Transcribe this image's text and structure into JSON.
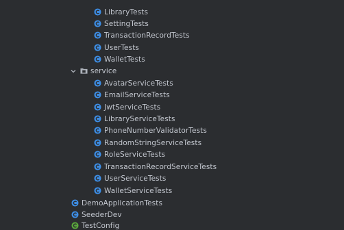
{
  "tree": {
    "colors": {
      "background": "#2b2d30",
      "text": "#c3c7cf",
      "test_class_icon": "#3d8ee6",
      "config_class_icon": "#5aa83c",
      "folder_icon": "#aeb3bb"
    },
    "items": [
      {
        "label": "LibraryTests",
        "icon": "test-class-icon",
        "level": 3
      },
      {
        "label": "SettingTests",
        "icon": "test-class-icon",
        "level": 3
      },
      {
        "label": "TransactionRecordTests",
        "icon": "test-class-icon",
        "level": 3
      },
      {
        "label": "UserTests",
        "icon": "test-class-icon",
        "level": 3
      },
      {
        "label": "WalletTests",
        "icon": "test-class-icon",
        "level": 3
      },
      {
        "label": "service",
        "icon": "package-folder-icon",
        "level": 2,
        "expanded": true
      },
      {
        "label": "AvatarServiceTests",
        "icon": "test-class-icon",
        "level": 3
      },
      {
        "label": "EmailServiceTests",
        "icon": "test-class-icon",
        "level": 3
      },
      {
        "label": "JwtServiceTests",
        "icon": "test-class-icon",
        "level": 3
      },
      {
        "label": "LibraryServiceTests",
        "icon": "test-class-icon",
        "level": 3
      },
      {
        "label": "PhoneNumberValidatorTests",
        "icon": "test-class-icon",
        "level": 3
      },
      {
        "label": "RandomStringServiceTests",
        "icon": "test-class-icon",
        "level": 3
      },
      {
        "label": "RoleServiceTests",
        "icon": "test-class-icon",
        "level": 3
      },
      {
        "label": "TransactionRecordServiceTests",
        "icon": "test-class-icon",
        "level": 3
      },
      {
        "label": "UserServiceTests",
        "icon": "test-class-icon",
        "level": 3
      },
      {
        "label": "WalletServiceTests",
        "icon": "test-class-icon",
        "level": 3
      },
      {
        "label": "DemoApplicationTests",
        "icon": "test-class-icon",
        "level": 1
      },
      {
        "label": "SeederDev",
        "icon": "test-class-icon",
        "level": 1
      },
      {
        "label": "TestConfig",
        "icon": "config-class-icon",
        "level": 1
      }
    ]
  }
}
